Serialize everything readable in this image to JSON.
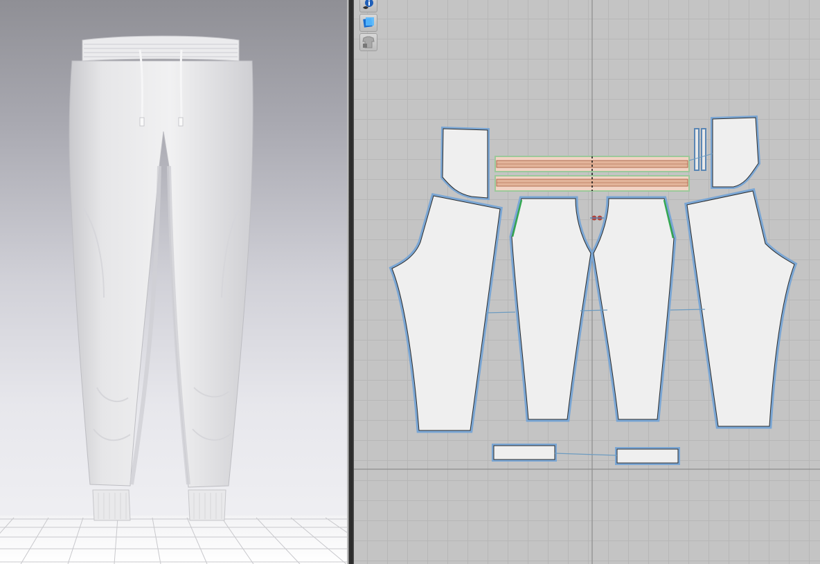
{
  "app": {
    "views": [
      "3d-avatar-window",
      "2d-pattern-window"
    ]
  },
  "toolbar": {
    "icons": [
      "info-visibility-icon",
      "texture-view-icon",
      "garment-lock-icon"
    ]
  },
  "garment": {
    "type": "jogger-pants",
    "color": "#ececee",
    "seam_line_color": "#5a86b4",
    "stitch_highlight_color": "#35a852",
    "elastic_color": "#e2b49a"
  },
  "pattern_pieces": [
    "left-pocket-bag",
    "right-pocket-bag",
    "waistband-top",
    "waistband-bottom",
    "left-back-leg",
    "left-front-leg",
    "right-front-leg",
    "right-back-leg",
    "left-cuff",
    "right-cuff",
    "drawstring-pair"
  ],
  "grid": {
    "color": "#b7b7b7",
    "axis_color": "#8d8d8d"
  }
}
